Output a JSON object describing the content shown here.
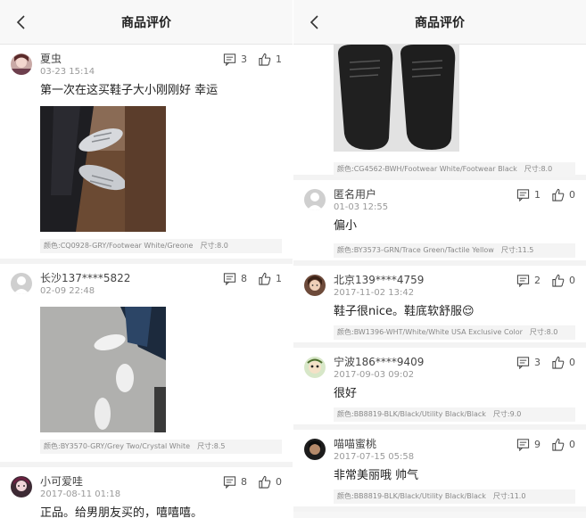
{
  "left": {
    "title": "商品评价",
    "reviews": [
      {
        "user": "夏虫",
        "date": "03-23 15:14",
        "comments": "3",
        "likes": "1",
        "text": "第一次在这买鞋子大小刚刚好 幸运",
        "color_label": "颜色:CQ0928-GRY/Footwear White/Greone",
        "size_label": "尺寸:8.0"
      },
      {
        "user": "长沙137****5822",
        "date": "02-09 22:48",
        "comments": "8",
        "likes": "1",
        "text": "",
        "color_label": "颜色:BY3570-GRY/Grey Two/Crystal White",
        "size_label": "尺寸:8.5"
      },
      {
        "user": "小可爱哇",
        "date": "2017-08-11 01:18",
        "comments": "8",
        "likes": "0",
        "text": "正品。给男朋友买的，嘻嘻嘻。"
      }
    ]
  },
  "right": {
    "title": "商品评价",
    "top_spec": {
      "color_label": "颜色:CG4562-BWH/Footwear White/Footwear Black",
      "size_label": "尺寸:8.0"
    },
    "reviews": [
      {
        "user": "匿名用户",
        "date": "01-03 12:55",
        "comments": "1",
        "likes": "0",
        "text": "偏小",
        "color_label": "颜色:BY3573-GRN/Trace Green/Tactile Yellow",
        "size_label": "尺寸:11.5"
      },
      {
        "user": "北京139****4759",
        "date": "2017-11-02 13:42",
        "comments": "2",
        "likes": "0",
        "text": "鞋子很nice。鞋底软舒服😌",
        "color_label": "颜色:BW1396-WHT/White/White USA Exclusive Color",
        "size_label": "尺寸:8.0"
      },
      {
        "user": "宁波186****9409",
        "date": "2017-09-03 09:02",
        "comments": "3",
        "likes": "0",
        "text": "很好",
        "color_label": "颜色:BB8819-BLK/Black/Utility Black/Black",
        "size_label": "尺寸:9.0"
      },
      {
        "user": "喵喵蜜桃",
        "date": "2017-07-15 05:58",
        "comments": "9",
        "likes": "0",
        "text": "非常美丽哦 帅气",
        "color_label": "颜色:BB8819-BLK/Black/Utility Black/Black",
        "size_label": "尺寸:11.0"
      }
    ]
  },
  "icons": {
    "back": "chevron-left-icon",
    "comment": "comment-icon",
    "like": "thumbs-up-icon"
  }
}
